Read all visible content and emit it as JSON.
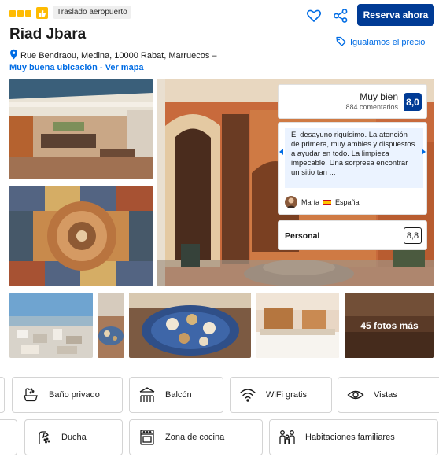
{
  "header": {
    "star_count": 3,
    "airport_badge": "Traslado aeropuerto",
    "reserve_button": "Reserva ahora",
    "price_match": "Igualamos el precio"
  },
  "hotel": {
    "name": "Riad Jbara",
    "address": "Rue Bendraou, Medina, 10000 Rabat, Marruecos –",
    "location_link": "Muy buena ubicación - Ver mapa"
  },
  "reviews": {
    "rating_label": "Muy bien",
    "review_count": "884 comentarios",
    "score": "8,0",
    "quote": "El desayuno riquísimo. La atención de primera, muy ambles y dispuestos a ayudar en todo. La limpieza impecable. Una sorpresa encontrar un sitio tan ...",
    "reviewer_name": "María",
    "reviewer_country": "España",
    "category_label": "Personal",
    "category_score": "8,8"
  },
  "gallery": {
    "more_photos": "45 fotos más"
  },
  "facilities": [
    {
      "label": "Baño privado",
      "icon": "bathtub-icon"
    },
    {
      "label": "Balcón",
      "icon": "balcony-icon"
    },
    {
      "label": "WiFi gratis",
      "icon": "wifi-icon"
    },
    {
      "label": "Vistas",
      "icon": "eye-icon"
    },
    {
      "label": "Ducha",
      "icon": "shower-icon"
    },
    {
      "label": "Zona de cocina",
      "icon": "oven-icon"
    },
    {
      "label": "Habitaciones familiares",
      "icon": "family-icon"
    }
  ],
  "colors": {
    "brand_blue": "#003b95",
    "link_blue": "#006ce4",
    "star_yellow": "#febb02",
    "quote_bg": "#ebf3ff"
  }
}
